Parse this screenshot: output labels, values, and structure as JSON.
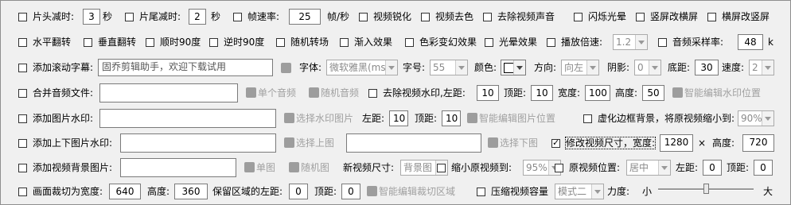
{
  "row1": {
    "trim_start": {
      "label": "片头减时:",
      "value": "3",
      "unit": "秒"
    },
    "trim_end": {
      "label": "片尾减时:",
      "value": "2",
      "unit": "秒"
    },
    "frame_rate": {
      "label": "帧速率:",
      "value": "25",
      "unit": "帧/秒"
    },
    "sharpen": "视频锐化",
    "desaturate": "视频去色",
    "remove_audio": "去除视频声音",
    "flash_halo": "闪烁光晕",
    "portrait_to_landscape": "竖屏改横屏",
    "landscape_to_portrait": "横屏改竖屏"
  },
  "row2": {
    "flip_h": "水平翻转",
    "flip_v": "垂直翻转",
    "rot_cw": "顺时90度",
    "rot_ccw": "逆时90度",
    "random_transition": "随机转场",
    "fade": "渐入效果",
    "color_effect": "色彩变幻效果",
    "light_effect": "光晕效果",
    "speed": {
      "label": "播放倍速:",
      "value": "1.2"
    },
    "sample_rate": {
      "label": "音频采样率:",
      "value": "48",
      "unit": "k"
    }
  },
  "row3": {
    "subtitle": {
      "label": "添加滚动字幕:",
      "value": "固乔剪辑助手，欢迎下载试用"
    },
    "font": {
      "label": "字体:",
      "value": "微软雅黑(msy"
    },
    "size": {
      "label": "字号:",
      "value": "55"
    },
    "color": {
      "label": "颜色:"
    },
    "direction": {
      "label": "方向:",
      "value": "向左"
    },
    "shadow": {
      "label": "阴影:",
      "value": "0"
    },
    "bottom": {
      "label": "底距:",
      "value": "30"
    },
    "speed": {
      "label": "速度:",
      "value": "2"
    }
  },
  "row4": {
    "merge_audio": {
      "label": "合并音频文件:",
      "value": ""
    },
    "single_audio": "单个音频",
    "random_audio": "随机音频",
    "remove_watermark": {
      "label": "去除视频水印,左距:",
      "value": "10"
    },
    "top": {
      "label": "顶距:",
      "value": "10"
    },
    "width": {
      "label": "宽度:",
      "value": "100"
    },
    "height": {
      "label": "高度:",
      "value": "50"
    },
    "smart_wm": "智能编辑水印位置"
  },
  "row5": {
    "image_wm": {
      "label": "添加图片水印:",
      "value": ""
    },
    "choose_wm_image": "选择水印图片",
    "left": {
      "label": "左距:",
      "value": "10"
    },
    "top": {
      "label": "顶距:",
      "value": "10"
    },
    "smart_img": "智能编辑图片位置",
    "blur_border": {
      "label": "虚化边框背景，将原视频缩小到:",
      "value": "90%"
    }
  },
  "row6": {
    "topbottom_wm": {
      "label": "添加上下图片水印:",
      "value": ""
    },
    "choose_top": "选择上图",
    "bottom_value": "",
    "choose_bottom": "选择下图",
    "resize": {
      "label": "修改视频尺寸，宽度:",
      "checked": true,
      "width": "1280",
      "times": "×",
      "height_label": "高度:",
      "height": "720"
    }
  },
  "row7": {
    "bg_image": {
      "label": "添加视频背景图片:",
      "value": ""
    },
    "single_image": "单图",
    "random_image": "随机图",
    "new_size": {
      "label": "新视频尺寸:",
      "value": "背景图"
    },
    "shrink": {
      "label": "缩小原视频到:",
      "value": "95%"
    },
    "position": {
      "label": "原视频位置:",
      "value": "居中"
    },
    "left": {
      "label": "左距:",
      "value": "0"
    },
    "top": {
      "label": "顶距:",
      "value": "0"
    }
  },
  "row8": {
    "crop": {
      "label": "画面裁切为宽度:",
      "value": "640"
    },
    "height": {
      "label": "高度:",
      "value": "360"
    },
    "keep_left": {
      "label": "保留区域的左距:",
      "value": "0"
    },
    "top": {
      "label": "顶距:",
      "value": "0"
    },
    "smart_crop": "智能编辑裁切区域",
    "compress": {
      "label": "压缩视频容量",
      "value": "模式二"
    },
    "strength": {
      "label": "力度:",
      "min": "小",
      "max": "大",
      "level": 0.5
    }
  }
}
